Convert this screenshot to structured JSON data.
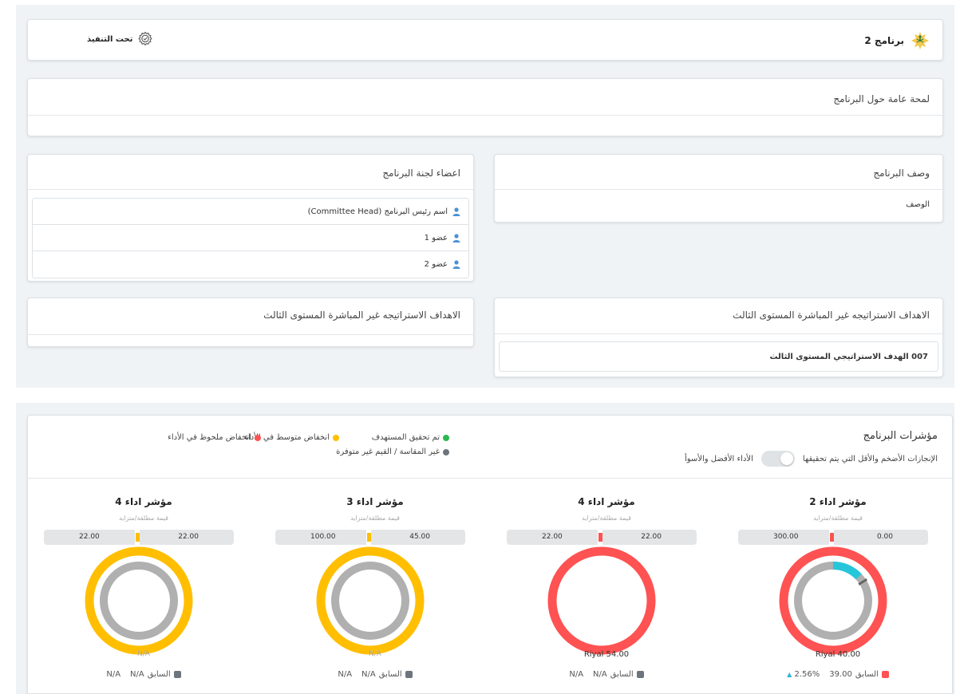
{
  "header": {
    "program_title": "برنامج 2",
    "status_label": "تحت التنفيذ"
  },
  "overview": {
    "title": "لمحة عامة حول البرنامج"
  },
  "description": {
    "title": "وصف البرنامج",
    "text": "الوصف"
  },
  "committee": {
    "title": "اعضاء لجنة البرنامج",
    "members": [
      {
        "name": "اسم رئيس البرنامج (Committee Head)"
      },
      {
        "name": "عضو 1"
      },
      {
        "name": "عضو 2"
      }
    ]
  },
  "goals_right": {
    "title": "الاهداف الاستراتيجه غير المباشرة المستوى الثالث",
    "items": [
      "007 الهدف الاستراتيجي المستوى الثالث"
    ]
  },
  "goals_left": {
    "title": "الاهداف الاستراتيجه غير المباشرة المستوى الثالث"
  },
  "indicators": {
    "title": "مؤشرات البرنامج",
    "subtitle": "الإنجازات الأضخم والأقل التي يتم تحقيقها",
    "toggle_label": "الأداء الأفضل والأسوأ",
    "toggle_on": false,
    "legend": {
      "achieved": "تم تحقيق المستهدف",
      "medium": "انخفاض متوسط في الأداء",
      "severe": "انخفاض ملحوظ في الأداء",
      "na": "غير المقاسة / القيم غير متوفرة"
    },
    "colors": {
      "green": "#2db84d",
      "yellow": "#ffbf00",
      "red": "#ff5252",
      "gray": "#6c757d",
      "inner": "#b0b0b0",
      "cyan": "#26c6da"
    },
    "previous_label": "السابق",
    "kpis": [
      {
        "title": "مؤشر اداء 2",
        "type": "قيمة مطلقة/متزايد",
        "min": "0.00",
        "max": "300.00",
        "status": "red",
        "progress": 0.13,
        "value": "Riyal 40.00",
        "previous": "39.00",
        "change": "2.56%",
        "has_change": true
      },
      {
        "title": "مؤشر اداء 4",
        "type": "قيمة مطلقة/متزايد",
        "min": "22.00",
        "max": "22.00",
        "status": "red",
        "progress": 0,
        "value": "Riyal 54.00",
        "previous": "N/A",
        "change": "N/A",
        "has_change": false
      },
      {
        "title": "مؤشر اداء 3",
        "type": "قيمة مطلقة/متزايد",
        "min": "45.00",
        "max": "100.00",
        "status": "yellow",
        "progress": 0,
        "value": "N/A",
        "previous": "N/A",
        "change": "N/A",
        "has_change": false
      },
      {
        "title": "مؤشر اداء 4",
        "type": "قيمة مطلقة/متزايد",
        "min": "22.00",
        "max": "22.00",
        "status": "yellow",
        "progress": 0,
        "value": "N/A",
        "previous": "N/A",
        "change": "N/A",
        "has_change": false
      }
    ]
  }
}
